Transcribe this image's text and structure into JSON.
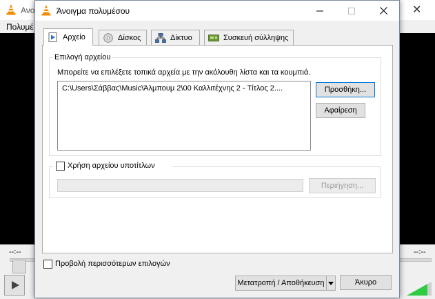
{
  "background_window": {
    "title": "Ανο",
    "menu_first": "Πολυμέ",
    "time_elapsed": "--:--",
    "time_total": "--:--",
    "volume_color": "#2ecc40"
  },
  "dialog": {
    "title": "Άνοιγμα πολυμέσου",
    "tabs": [
      {
        "label": "Αρχείο",
        "icon": "file-play-icon",
        "active": true
      },
      {
        "label": "Δίσκος",
        "icon": "disc-icon",
        "active": false
      },
      {
        "label": "Δίκτυο",
        "icon": "network-icon",
        "active": false
      },
      {
        "label": "Συσκευή σύλληψης",
        "icon": "capture-card-icon",
        "active": false
      }
    ],
    "file_selection": {
      "group_label": "Επιλογή αρχείου",
      "hint": "Μπορείτε να επιλέξετε τοπικά αρχεία με την ακόλουθη λίστα και τα κουμπιά.",
      "files": [
        "C:\\Users\\Σάββας\\Music\\Άλμπουμ 2\\00 Καλλιτέχνης 2 - Τίτλος 2...."
      ],
      "add_button": "Προσθήκη...",
      "remove_button": "Αφαίρεση"
    },
    "subtitles": {
      "checkbox_label": "Χρήση αρχείου υποτίτλων",
      "checked": false,
      "path_value": "",
      "browse_button": "Περιήγηση..."
    },
    "more_options_label": "Προβολή περισσότερων επιλογών",
    "more_options_checked": false,
    "convert_button": "Μετατροπή / Αποθήκευση",
    "cancel_button": "Άκυρο"
  }
}
